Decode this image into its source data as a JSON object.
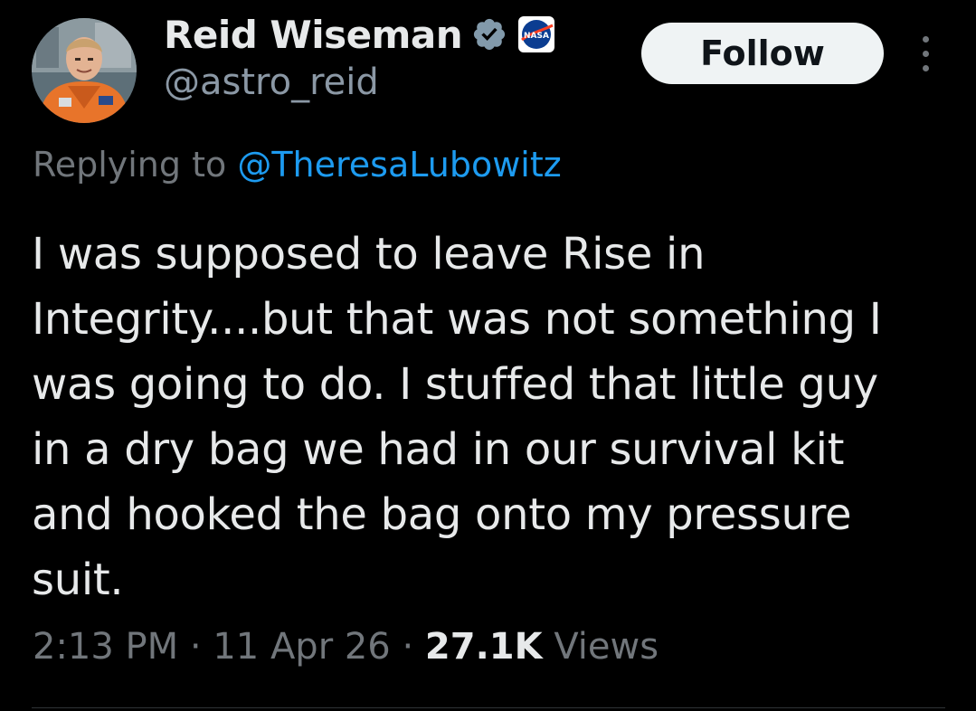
{
  "author": {
    "display_name": "Reid Wiseman",
    "handle": "@astro_reid",
    "avatar": "astronaut-avatar",
    "verified_icon": "verified-badge-icon",
    "affiliation_icon": "nasa-logo-icon"
  },
  "actions": {
    "follow_label": "Follow",
    "more_icon": "more-options-icon"
  },
  "reply": {
    "prefix": "Replying to ",
    "mention": "@TheresaLubowitz"
  },
  "tweet": {
    "lines": [
      "I was supposed to leave Rise in",
      "Integrity....but that was not something I",
      "was going to do. I stuffed that little guy",
      "in a dry bag we had in our survival kit",
      "and hooked the bag onto my pressure",
      "suit."
    ]
  },
  "meta": {
    "time": "2:13 PM",
    "sep1": " · ",
    "date": "11 Apr 26",
    "sep2": " · ",
    "views_count": "27.1K",
    "views_label": " Views"
  },
  "colors": {
    "background": "#000000",
    "text": "#e7e9ea",
    "secondary": "#71767b",
    "link": "#1d9bf0",
    "follow_bg": "#eff3f4"
  }
}
